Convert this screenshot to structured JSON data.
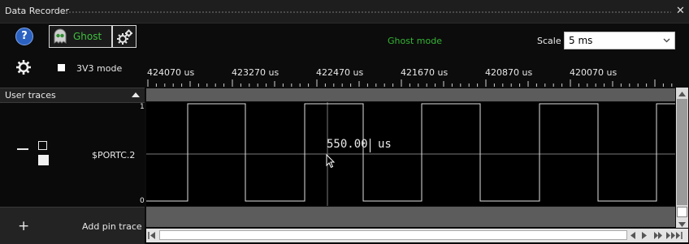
{
  "window": {
    "title": "Data Recorder",
    "close_glyph": "✕"
  },
  "toolbar": {
    "help_icon": "help-icon",
    "help_glyph": "?",
    "ghost_label": "Ghost",
    "ghost_icon": "ghost-icon",
    "ghost_settings_icon": "gears-icon",
    "mode_status": "Ghost mode",
    "scale_label": "Scale",
    "scale_value": "5 ms",
    "scale_chevron_icon": "chevron-down-icon"
  },
  "settings": {
    "gear_icon": "gear-icon",
    "v3_label": "3V3 mode",
    "v3_checked": false
  },
  "ruler": {
    "labels": [
      "424070 us",
      "423270 us",
      "422470 us",
      "421670 us",
      "420870 us",
      "420070 us"
    ]
  },
  "panel": {
    "header": "User traces",
    "trace_name": "$PORTC.2",
    "add_label": "Add pin trace",
    "add_glyph": "+"
  },
  "plot": {
    "y_high": "1",
    "y_low": "0",
    "measurement_value": "550.00",
    "measurement_unit": "us",
    "signal_color": "#e0e0e0",
    "status_green": "#35b535"
  }
}
